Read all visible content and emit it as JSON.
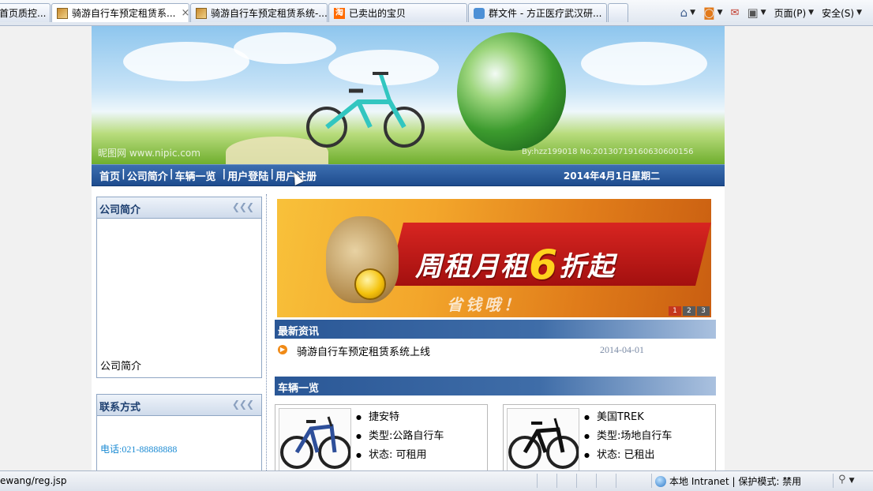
{
  "browser": {
    "tabs": [
      {
        "label": "首页质控..."
      },
      {
        "label": "骑游自行车预定租赁系...",
        "close": "×"
      },
      {
        "label": "骑游自行车预定租赁系统-..."
      },
      {
        "label": "已卖出的宝贝",
        "icon_text": "淘"
      },
      {
        "label": "群文件 - 方正医疗武汉研..."
      }
    ],
    "toolbar": {
      "page_label": "页面(P)",
      "safety_label": "安全(S)"
    },
    "status": {
      "url": "ewang/reg.jsp",
      "zone": "本地 Intranet | 保护模式: 禁用"
    }
  },
  "site": {
    "banner": {
      "watermark_left": "昵图网 www.nipic.com",
      "watermark_right": "By:hzz199018 No.20130719160630600156"
    },
    "nav": {
      "links": [
        "首页",
        "公司简介",
        "车辆一览",
        "用户登陆",
        "用户注册"
      ],
      "date": "2014年4月1日星期二"
    },
    "sidebar": {
      "company": {
        "title": "公司简介",
        "body": "公司简介"
      },
      "contact": {
        "title": "联系方式",
        "phone": "电话:021-88888888"
      }
    },
    "promo": {
      "title_a": "周租月租",
      "title_b": "6",
      "title_c": "折起",
      "subtitle": "省钱哦！",
      "pages": [
        "1",
        "2",
        "3"
      ]
    },
    "news": {
      "title": "最新资讯",
      "items": [
        {
          "title": "骑游自行车预定租赁系统上线",
          "date": "2014-04-01"
        }
      ]
    },
    "vehicles": {
      "title": "车辆一览",
      "items": [
        {
          "name": "捷安特",
          "type": "类型:公路自行车",
          "status": "状态: 可租用"
        },
        {
          "name": "美国TREK",
          "type": "类型:场地自行车",
          "status": "状态: 已租出"
        }
      ]
    }
  },
  "colors": {
    "nav": "#1e4c8e",
    "section": "#2a5796",
    "promo_red": "#d82521",
    "promo_gold": "#ffd21d",
    "phone": "#1a8ad3"
  }
}
